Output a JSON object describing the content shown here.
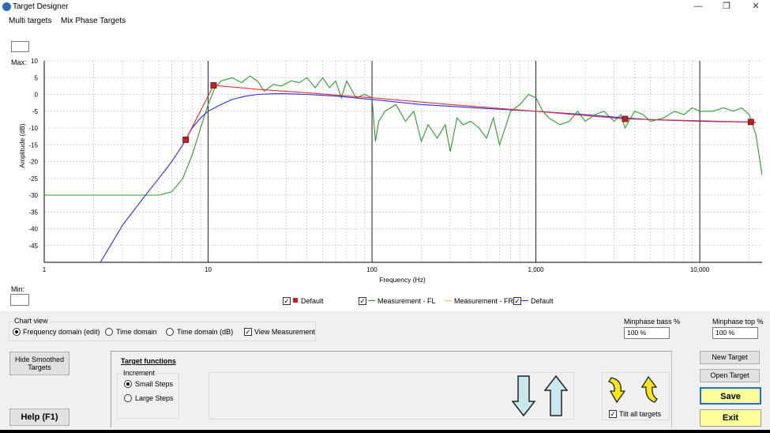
{
  "window": {
    "title": "Target Designer"
  },
  "menu": {
    "items": [
      "Multi targets",
      "Mix Phase Targets"
    ]
  },
  "chart": {
    "max_label": "Max:",
    "min_label": "Min:",
    "max_value": "10",
    "min_value": "",
    "legend": {
      "default_1": "Default",
      "measurement_fl": "Measurement - FL",
      "measurement_fr": "Measurement - FR",
      "default_2": "Default"
    }
  },
  "chart_data": {
    "type": "line",
    "xlabel": "Frequency (Hz)",
    "ylabel": "Amplitude (dB)",
    "xscale": "log",
    "xlim": [
      1,
      24000
    ],
    "ylim": [
      -50,
      10
    ],
    "x_tick_labels": [
      "1",
      "10",
      "100",
      "1,000",
      "10,000"
    ],
    "x_ticks": [
      1,
      10,
      100,
      1000,
      10000
    ],
    "y_ticks": [
      10,
      5,
      0,
      -5,
      -10,
      -15,
      -20,
      -25,
      -30,
      -35,
      -40,
      -45
    ],
    "grid": true,
    "legend_placement": "bottom",
    "series": [
      {
        "name": "Measurement - FL",
        "color": "#2e9b2e",
        "x": [
          1,
          2,
          3,
          4,
          5,
          6,
          7,
          8,
          9,
          10,
          11,
          12,
          14,
          16,
          18,
          20,
          22,
          25,
          28,
          32,
          36,
          40,
          45,
          50,
          55,
          60,
          65,
          70,
          80,
          90,
          100,
          105,
          110,
          120,
          140,
          160,
          180,
          200,
          220,
          250,
          280,
          300,
          330,
          360,
          400,
          450,
          500,
          550,
          600,
          650,
          700,
          800,
          900,
          1000,
          1100,
          1200,
          1400,
          1600,
          1800,
          2000,
          2300,
          2600,
          3000,
          3300,
          3500,
          4000,
          4500,
          5000,
          6000,
          7000,
          8000,
          9000,
          10000,
          12000,
          14000,
          16000,
          18000,
          20000,
          22000,
          24000
        ],
        "y": [
          -30,
          -30,
          -30,
          -30,
          -30,
          -29,
          -25,
          -18,
          -10,
          -3,
          2,
          4,
          5,
          3.5,
          5.5,
          4,
          1,
          3,
          2.5,
          4,
          3.5,
          5,
          2,
          5,
          2,
          4,
          -1,
          4,
          -1,
          0,
          -1,
          -14,
          -8,
          -5,
          -3,
          -8,
          -5,
          -14,
          -9,
          -13,
          -9,
          -17,
          -7,
          -9,
          -8,
          -10,
          -13,
          -7,
          -15,
          -10,
          -5,
          -3,
          0,
          -1,
          -5,
          -7,
          -9,
          -8,
          -5,
          -8,
          -6,
          -5,
          -8,
          -6,
          -10,
          -5,
          -6,
          -8,
          -7,
          -5,
          -6,
          -4,
          -5,
          -5,
          -4,
          -5,
          -4,
          -6,
          -12,
          -24
        ]
      },
      {
        "name": "Default",
        "color": "#2d2de6",
        "x": [
          1,
          2,
          2.2,
          3,
          4,
          5,
          6,
          7,
          8,
          9,
          10,
          12,
          14,
          17,
          20,
          25,
          30,
          40,
          60,
          100,
          200,
          500,
          1000,
          2000,
          3500,
          5000,
          10000,
          20000,
          22000
        ],
        "y": [
          -54,
          -54,
          -50,
          -39,
          -31,
          -25,
          -20,
          -15,
          -10,
          -7,
          -5,
          -3,
          -1.5,
          -0.5,
          0,
          0.2,
          0.2,
          0,
          -0.5,
          -1.5,
          -3,
          -4.2,
          -5,
          -6,
          -7,
          -7.5,
          -8,
          -8.2,
          -8.3
        ]
      },
      {
        "name": "Default",
        "color": "#e03030",
        "x": [
          7.3,
          10.8,
          20,
          40,
          100,
          300,
          1000,
          3500,
          20500,
          22000
        ],
        "y": [
          -13.5,
          2.7,
          1.5,
          0.5,
          -1,
          -3,
          -5,
          -7.3,
          -8.2,
          -8.3
        ]
      }
    ],
    "control_points": {
      "x": [
        7.3,
        10.8,
        3500,
        20500
      ],
      "y": [
        -13.5,
        2.7,
        -7.3,
        -8.2
      ]
    }
  },
  "chart_view": {
    "title": "Chart view",
    "options": [
      "Frequency domain (edit)",
      "Time domain",
      "Time domain (dB)"
    ],
    "selected": "Frequency domain (edit)",
    "view_measurement": "View Measurement"
  },
  "minphase": {
    "bass_label": "Minphase bass %",
    "bass_value": "100 %",
    "top_label": "Minphase top %",
    "top_value": "100 %"
  },
  "buttons": {
    "hide_smoothed": "Hide Smoothed Targets",
    "help": "Help (F1)",
    "new_target": "New Target",
    "open_target": "Open Target",
    "save": "Save",
    "exit": "Exit"
  },
  "target_functions": {
    "title": "Target functions",
    "increment": "Increment",
    "small_steps": "Small Steps",
    "large_steps": "Large Steps",
    "tilt_all": "Tilt all targets"
  }
}
